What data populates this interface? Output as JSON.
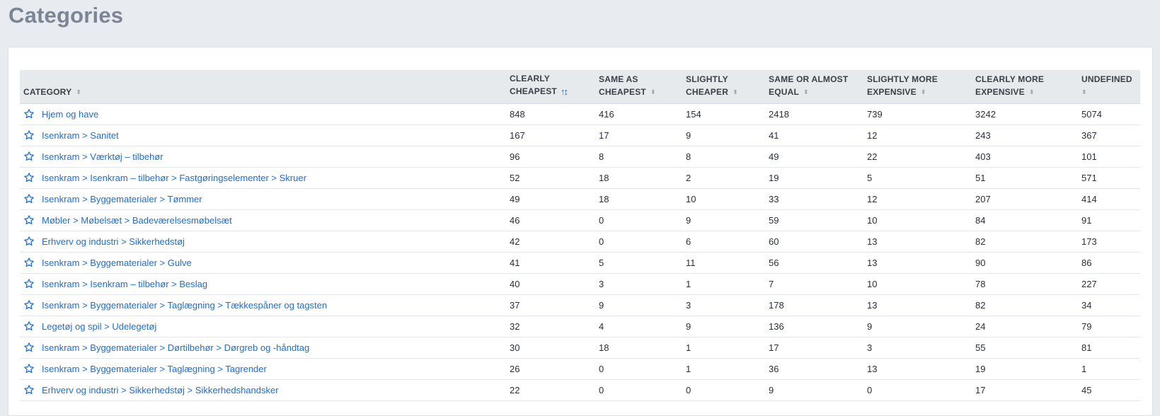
{
  "page": {
    "title": "Categories"
  },
  "colors": {
    "background": "#e8ecf0",
    "link": "#1a6fd0",
    "header_bg": "#e7eaed",
    "title": "#7b8595"
  },
  "icons": {
    "row_action": "star-outline-icon",
    "sort": "sort-updown-icon",
    "sort_active": "sort-descending-icon"
  },
  "table": {
    "columns": [
      {
        "line1": "",
        "line2": "CATEGORY",
        "sort": "none"
      },
      {
        "line1": "CLEARLY",
        "line2": "CHEAPEST",
        "sort": "active"
      },
      {
        "line1": "SAME AS",
        "line2": "CHEAPEST",
        "sort": "none"
      },
      {
        "line1": "SLIGHTLY",
        "line2": "CHEAPER",
        "sort": "none"
      },
      {
        "line1": "SAME OR ALMOST",
        "line2": "EQUAL",
        "sort": "none"
      },
      {
        "line1": "SLIGHTLY MORE",
        "line2": "EXPENSIVE",
        "sort": "none"
      },
      {
        "line1": "CLEARLY MORE",
        "line2": "EXPENSIVE",
        "sort": "none"
      },
      {
        "line1": "UNDEFINED",
        "line2": "",
        "sort": "none"
      }
    ],
    "rows": [
      {
        "category": "Hjem og have",
        "values": [
          "848",
          "416",
          "154",
          "2418",
          "739",
          "3242",
          "5074"
        ]
      },
      {
        "category": "Isenkram > Sanitet",
        "values": [
          "167",
          "17",
          "9",
          "41",
          "12",
          "243",
          "367"
        ]
      },
      {
        "category": "Isenkram > Værktøj – tilbehør",
        "values": [
          "96",
          "8",
          "8",
          "49",
          "22",
          "403",
          "101"
        ]
      },
      {
        "category": "Isenkram > Isenkram – tilbehør > Fastgøringselementer > Skruer",
        "values": [
          "52",
          "18",
          "2",
          "19",
          "5",
          "51",
          "571"
        ]
      },
      {
        "category": "Isenkram > Byggematerialer > Tømmer",
        "values": [
          "49",
          "18",
          "10",
          "33",
          "12",
          "207",
          "414"
        ]
      },
      {
        "category": "Møbler > Møbelsæt > Badeværelsesmøbelsæt",
        "values": [
          "46",
          "0",
          "9",
          "59",
          "10",
          "84",
          "91"
        ]
      },
      {
        "category": "Erhverv og industri > Sikkerhedstøj",
        "values": [
          "42",
          "0",
          "6",
          "60",
          "13",
          "82",
          "173"
        ]
      },
      {
        "category": "Isenkram > Byggematerialer > Gulve",
        "values": [
          "41",
          "5",
          "11",
          "56",
          "13",
          "90",
          "86"
        ]
      },
      {
        "category": "Isenkram > Isenkram – tilbehør > Beslag",
        "values": [
          "40",
          "3",
          "1",
          "7",
          "10",
          "78",
          "227"
        ]
      },
      {
        "category": "Isenkram > Byggematerialer > Taglægning > Tækkespåner og tagsten",
        "values": [
          "37",
          "9",
          "3",
          "178",
          "13",
          "82",
          "34"
        ]
      },
      {
        "category": "Legetøj og spil > Udelegetøj",
        "values": [
          "32",
          "4",
          "9",
          "136",
          "9",
          "24",
          "79"
        ]
      },
      {
        "category": "Isenkram > Byggematerialer > Dørtilbehør > Dørgreb og -håndtag",
        "values": [
          "30",
          "18",
          "1",
          "17",
          "3",
          "55",
          "81"
        ]
      },
      {
        "category": "Isenkram > Byggematerialer > Taglægning > Tagrender",
        "values": [
          "26",
          "0",
          "1",
          "36",
          "13",
          "19",
          "1"
        ]
      },
      {
        "category": "Erhverv og industri > Sikkerhedstøj > Sikkerhedshandsker",
        "values": [
          "22",
          "0",
          "0",
          "9",
          "0",
          "17",
          "45"
        ]
      }
    ]
  }
}
